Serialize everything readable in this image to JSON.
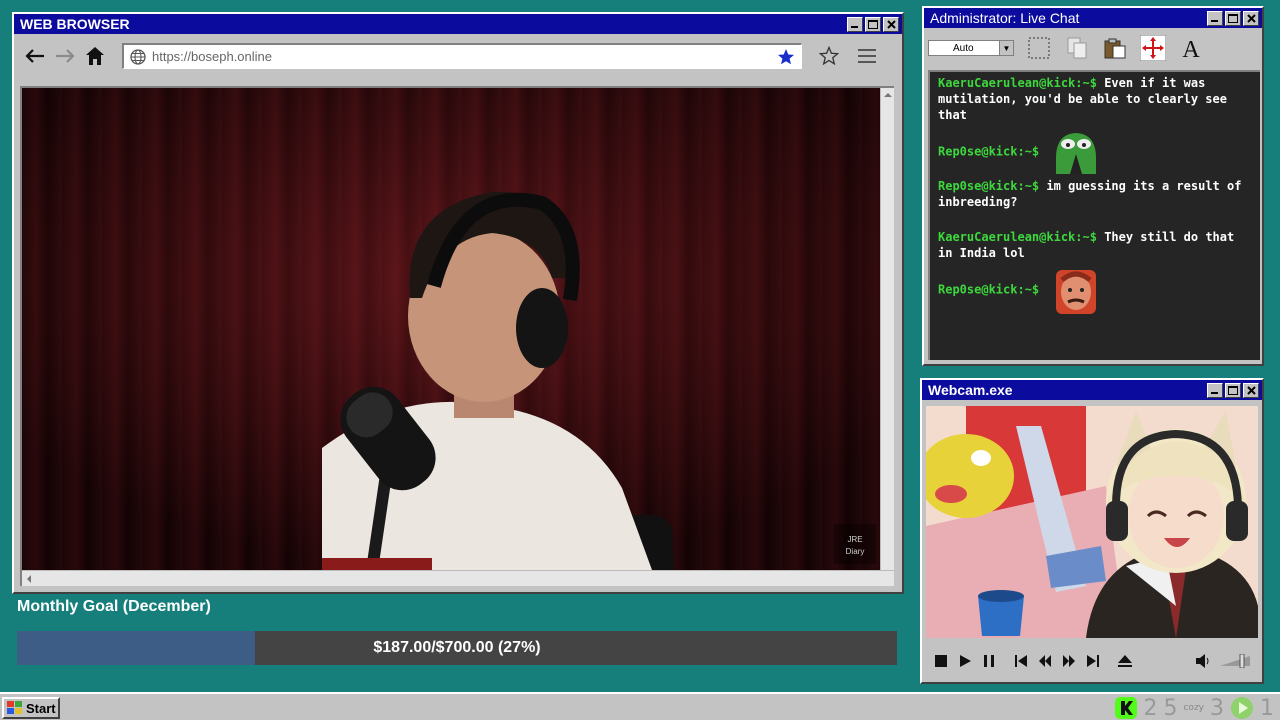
{
  "browser": {
    "title": "WEB BROWSER",
    "url": "https://boseph.online",
    "video_watermark": "JRE Diary"
  },
  "goal": {
    "title": "Monthly Goal (December)",
    "progress_text": "$187.00/$700.00 (27%)",
    "progress_fraction": 0.27,
    "fill_color": "#3d5c86"
  },
  "chat": {
    "title": "Administrator: Live Chat",
    "font_select": "Auto",
    "messages": [
      {
        "user": "KaeruCaerulean@kick:~$",
        "text": "Even if it was mutilation, you'd be able to clearly see that",
        "emote": null
      },
      {
        "user": "Rep0se@kick:~$",
        "text": "",
        "emote": "pepe-emote"
      },
      {
        "user": "Rep0se@kick:~$",
        "text": "im guessing its a result of inbreeding?",
        "emote": null
      },
      {
        "user": "KaeruCaerulean@kick:~$",
        "text": "They still do that in India lol",
        "emote": null
      },
      {
        "user": "Rep0se@kick:~$",
        "text": "",
        "emote": "face-emote"
      }
    ]
  },
  "webcam": {
    "title": "Webcam.exe"
  },
  "taskbar": {
    "start_label": "Start",
    "tray_1": "2",
    "tray_2": "5",
    "tray_cozy": "cozy",
    "tray_3": "3",
    "tray_4": "1"
  },
  "colors": {
    "desktop": "#167f7c",
    "title_bar": "#0b0b9e",
    "chat_user": "#3dd83d"
  }
}
